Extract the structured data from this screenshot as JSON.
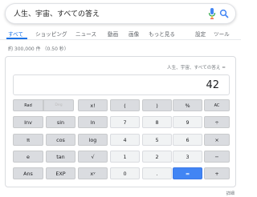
{
  "search": {
    "query": "人生、宇宙、すべての答え"
  },
  "tabs": [
    {
      "label": "すべて"
    },
    {
      "label": "ショッピング"
    },
    {
      "label": "ニュース"
    },
    {
      "label": "動画"
    },
    {
      "label": "画像"
    },
    {
      "label": "もっと見る"
    },
    {
      "label": "設定"
    },
    {
      "label": "ツール"
    }
  ],
  "stats": "約 300,000 件 （0.50 秒）",
  "calculator": {
    "expression": "人生、宇宙、すべての答え =",
    "result": "42",
    "keys": [
      {
        "label": "Rad"
      },
      {
        "label": "Deg"
      },
      {
        "label": "x!"
      },
      {
        "label": "("
      },
      {
        "label": ")"
      },
      {
        "label": "%"
      },
      {
        "label": "AC"
      },
      {
        "label": "Inv"
      },
      {
        "label": "sin"
      },
      {
        "label": "ln"
      },
      {
        "label": "7"
      },
      {
        "label": "8"
      },
      {
        "label": "9"
      },
      {
        "label": "÷"
      },
      {
        "label": "π"
      },
      {
        "label": "cos"
      },
      {
        "label": "log"
      },
      {
        "label": "4"
      },
      {
        "label": "5"
      },
      {
        "label": "6"
      },
      {
        "label": "×"
      },
      {
        "label": "e"
      },
      {
        "label": "tan"
      },
      {
        "label": "√"
      },
      {
        "label": "1"
      },
      {
        "label": "2"
      },
      {
        "label": "3"
      },
      {
        "label": "−"
      },
      {
        "label": "Ans"
      },
      {
        "label": "EXP"
      },
      {
        "label": "xʸ"
      },
      {
        "label": "0"
      },
      {
        "label": "."
      },
      {
        "label": "="
      },
      {
        "label": "+"
      }
    ]
  },
  "footer": {
    "more_info": "詳細"
  },
  "colors": {
    "accent": "#1a73e8",
    "equals_key": "#4285f4"
  }
}
